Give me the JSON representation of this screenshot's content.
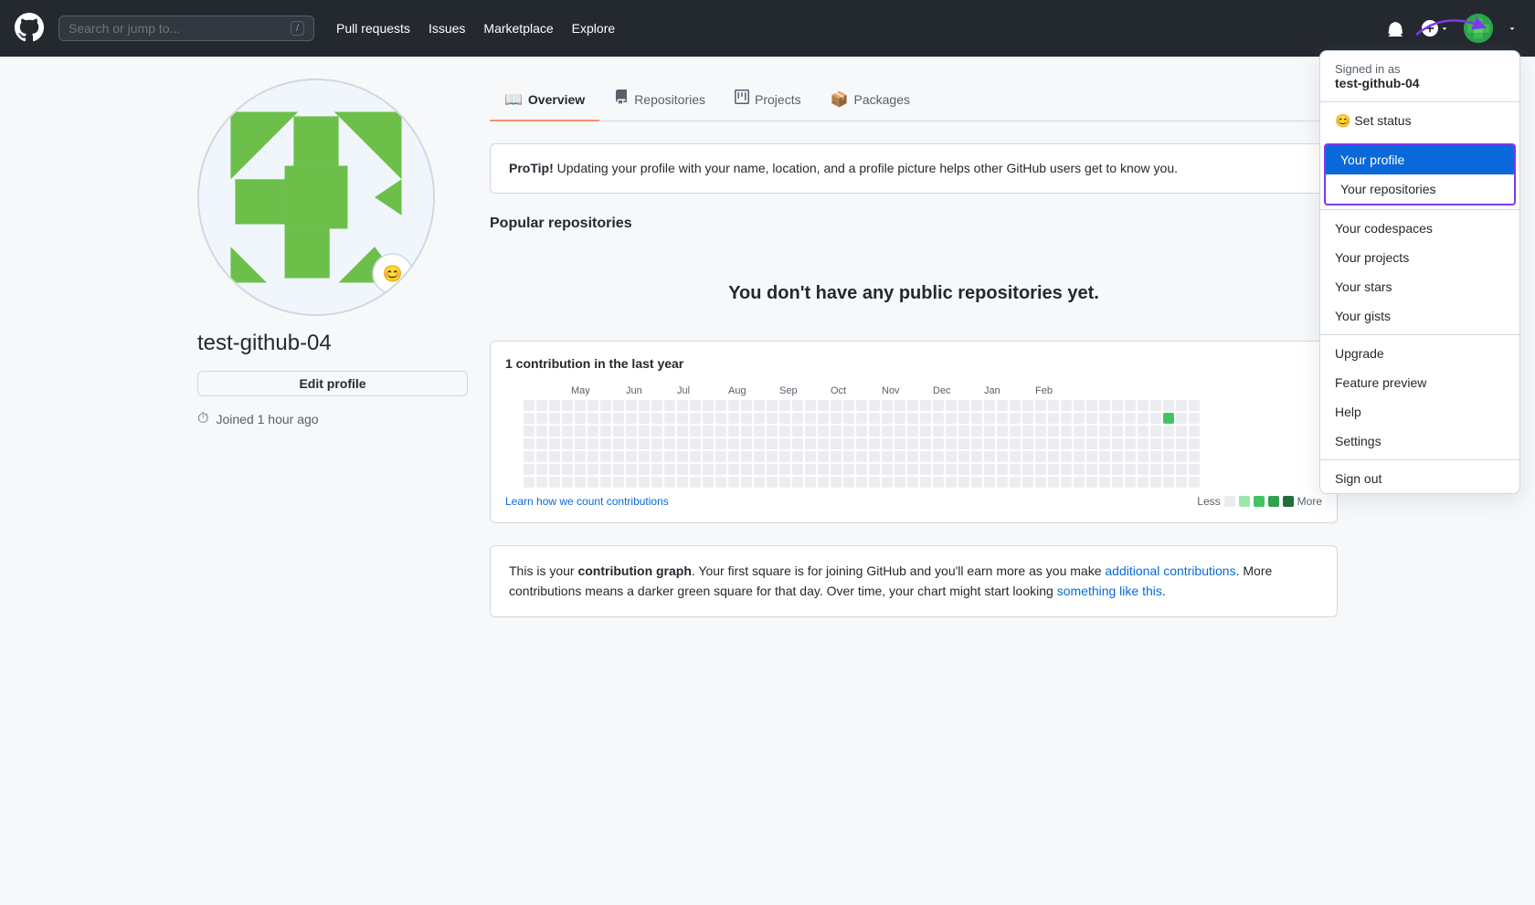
{
  "header": {
    "search_placeholder": "Search or jump to...",
    "slash_key": "/",
    "nav_items": [
      {
        "id": "pull-requests",
        "label": "Pull requests"
      },
      {
        "id": "issues",
        "label": "Issues"
      },
      {
        "id": "marketplace",
        "label": "Marketplace"
      },
      {
        "id": "explore",
        "label": "Explore"
      }
    ],
    "notifications_icon": "🔔",
    "new_icon": "⊕",
    "avatar_alt": "User avatar"
  },
  "dropdown": {
    "signed_in_label": "Signed in as",
    "username": "test-github-04",
    "items": [
      {
        "id": "set-status",
        "label": "Set status",
        "icon": "😊",
        "active": false,
        "highlighted": false
      },
      {
        "id": "your-profile",
        "label": "Your profile",
        "active": true,
        "highlighted": true
      },
      {
        "id": "your-repositories",
        "label": "Your repositories",
        "active": false,
        "highlighted": true
      },
      {
        "id": "your-codespaces",
        "label": "Your codespaces",
        "active": false,
        "highlighted": false
      },
      {
        "id": "your-projects",
        "label": "Your projects",
        "active": false,
        "highlighted": false
      },
      {
        "id": "your-stars",
        "label": "Your stars",
        "active": false,
        "highlighted": false
      },
      {
        "id": "your-gists",
        "label": "Your gists",
        "active": false,
        "highlighted": false
      },
      {
        "id": "upgrade",
        "label": "Upgrade",
        "active": false,
        "highlighted": false
      },
      {
        "id": "feature-preview",
        "label": "Feature preview",
        "active": false,
        "highlighted": false
      },
      {
        "id": "help",
        "label": "Help",
        "active": false,
        "highlighted": false
      },
      {
        "id": "settings",
        "label": "Settings",
        "active": false,
        "highlighted": false
      },
      {
        "id": "sign-out",
        "label": "Sign out",
        "active": false,
        "highlighted": false
      }
    ]
  },
  "sidebar": {
    "username": "test-github-04",
    "edit_profile_label": "Edit profile",
    "joined_label": "Joined 1 hour ago"
  },
  "tabs": [
    {
      "id": "overview",
      "label": "Overview",
      "icon": "📖",
      "active": true
    },
    {
      "id": "repositories",
      "label": "Repositories",
      "icon": "⊞",
      "active": false
    },
    {
      "id": "projects",
      "label": "Projects",
      "icon": "⊟",
      "active": false
    },
    {
      "id": "packages",
      "label": "Packages",
      "icon": "📦",
      "active": false
    }
  ],
  "protip": {
    "bold": "ProTip!",
    "text": " Updating your profile with your name, location, and a profile picture helps other GitHub users get to know you."
  },
  "popular_repos": {
    "title": "Popular repositories",
    "empty_message": "You don't have any public repositories yet."
  },
  "contributions": {
    "title_prefix": "1 contribution in the last year",
    "months": [
      "May",
      "Jun",
      "Jul",
      "Aug",
      "Sep",
      "Oct",
      "Nov",
      "Dec",
      "Jan",
      "Feb"
    ],
    "learn_link": "Learn how we count contributions",
    "less_label": "Less",
    "more_label": "More",
    "legend": [
      "#ebedf0",
      "#9be9a8",
      "#40c463",
      "#30a14e",
      "#216e39"
    ]
  },
  "contrib_text": {
    "part1": "This is your ",
    "bold1": "contribution graph",
    "part2": ". Your first square is for joining GitHub and you'll earn more as you make ",
    "link1": "additional contributions",
    "part3": ". More contributions means a darker green square for that day. Over time, your chart might start looking ",
    "link2": "something like this",
    "part4": "."
  }
}
